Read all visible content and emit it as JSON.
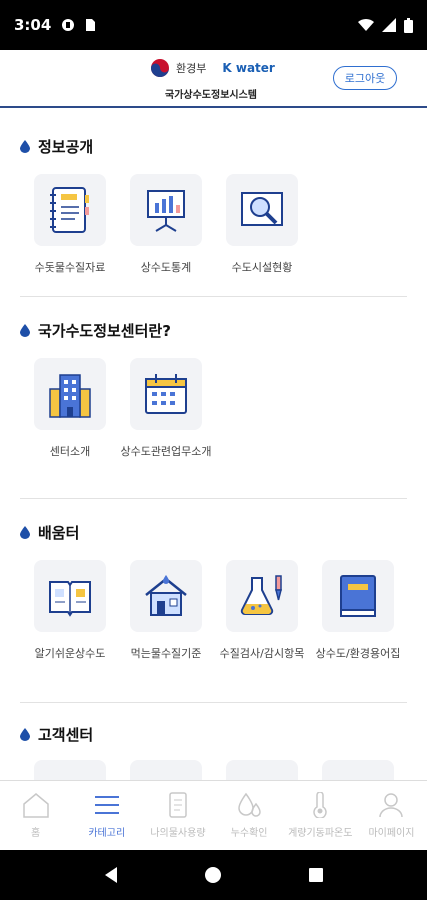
{
  "status": {
    "time": "3:04"
  },
  "header": {
    "ministry": "환경부",
    "kwater": "K water",
    "system_name": "국가상수도정보시스템",
    "logout": "로그아웃"
  },
  "sections": [
    {
      "title": "정보공개",
      "items": [
        "수돗물수질자료",
        "상수도통계",
        "수도시설현황"
      ]
    },
    {
      "title": "국가수도정보센터란?",
      "items": [
        "센터소개",
        "상수도관련업무소개"
      ]
    },
    {
      "title": "배움터",
      "items": [
        "알기쉬운상수도",
        "먹는물수질기준",
        "수질검사/감시항목",
        "상수도/환경용어집"
      ]
    },
    {
      "title": "고객센터",
      "items": []
    }
  ],
  "tabs": [
    {
      "label": "홈",
      "icon": "home-icon"
    },
    {
      "label": "카테고리",
      "icon": "menu-icon"
    },
    {
      "label": "나의물사용량",
      "icon": "document-icon"
    },
    {
      "label": "누수확인",
      "icon": "water-drop-icon"
    },
    {
      "label": "계량기동파온도",
      "icon": "thermometer-icon"
    },
    {
      "label": "마이페이지",
      "icon": "user-icon"
    }
  ],
  "colors": {
    "accent": "#2f6fd0",
    "active_tab": "#4a74d6",
    "drop": "#1e4fa8",
    "tile_bg": "#f2f3f6"
  }
}
